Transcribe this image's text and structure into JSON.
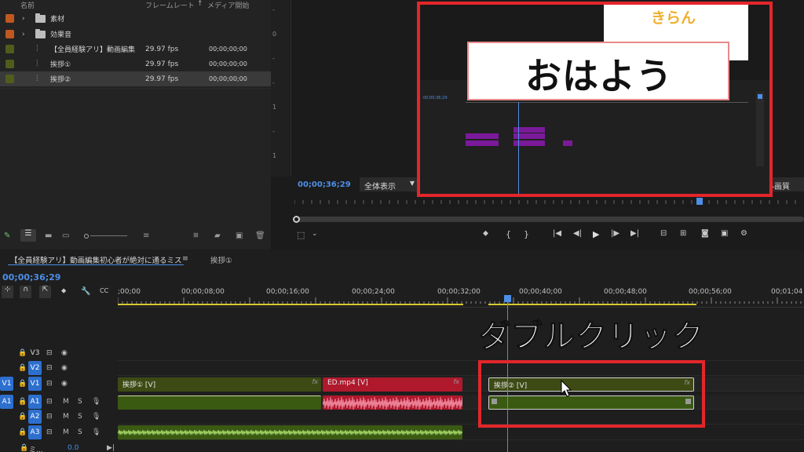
{
  "colors": {
    "accent_blue": "#2d6fcf",
    "playhead": "#4d8fe6",
    "highlight_red": "#e3262b",
    "clip_video_green": "#3d4a14",
    "clip_red": "#b0182c",
    "clip_audio_green": "#3a5a12"
  },
  "project": {
    "headers": {
      "name": "名前",
      "fps": "フレームレート",
      "start": "メディア開始"
    },
    "sort_arrow": "↑",
    "rows": [
      {
        "name": "素材",
        "fps": "",
        "start": "",
        "type": "folder",
        "swatch": "#c0581f"
      },
      {
        "name": "効果音",
        "fps": "",
        "start": "",
        "type": "folder",
        "swatch": "#c0581f"
      },
      {
        "name": "【全員経験アリ】動画編集",
        "fps": "29.97 fps",
        "start": "00;00;00;00",
        "type": "sequence",
        "swatch": "#4f5d1c"
      },
      {
        "name": "挨拶①",
        "fps": "29.97 fps",
        "start": "00;00;00;00",
        "type": "sequence",
        "swatch": "#4f5d1c"
      },
      {
        "name": "挨拶②",
        "fps": "29.97 fps",
        "start": "00;00;00;00",
        "type": "sequence",
        "swatch": "#4f5d1c"
      }
    ]
  },
  "monitor": {
    "ruler_marks": [
      "-",
      "0",
      "-",
      "-",
      "1",
      "-",
      "1"
    ],
    "timecode": "00;00;36;29",
    "zoom_select": "全体表示",
    "quality_partial": "ル画質"
  },
  "video": {
    "caption_main": "おはよう",
    "caption_top": "きらん",
    "inner_timecode": "00;00;36;29"
  },
  "timeline": {
    "tab_active": "【全員経験アリ】動画編集初心者が絶対に通るミス",
    "tab_menu": "≡",
    "tab_second": "挨拶①",
    "timecode": "00;00;36;29",
    "ruler": [
      ";00;00",
      "00;00;08;00",
      "00;00;16;00",
      "00;00;24;00",
      "00;00;32;00",
      "00;00;40;00",
      "00;00;48;00",
      "00;00;56;00",
      "00;01;04"
    ],
    "overlay_text": "ダブルクリック",
    "tracks": [
      {
        "id": "V3",
        "src": "",
        "kind": "video"
      },
      {
        "id": "V2",
        "src": "",
        "kind": "video"
      },
      {
        "id": "V1",
        "src": "V1",
        "kind": "video"
      },
      {
        "id": "A1",
        "src": "A1",
        "kind": "audio"
      },
      {
        "id": "A2",
        "src": "",
        "kind": "audio"
      },
      {
        "id": "A3",
        "src": "",
        "kind": "audio"
      }
    ],
    "track_buttons": {
      "mute": "M",
      "solo": "S"
    },
    "mix_label": "ミ...",
    "mix_value": "0.0",
    "clips": {
      "v1_a": "挨拶① [V]",
      "v1_b": "ED.mp4 [V]",
      "v1_c": "挨拶② [V]",
      "fx": "fx"
    }
  }
}
